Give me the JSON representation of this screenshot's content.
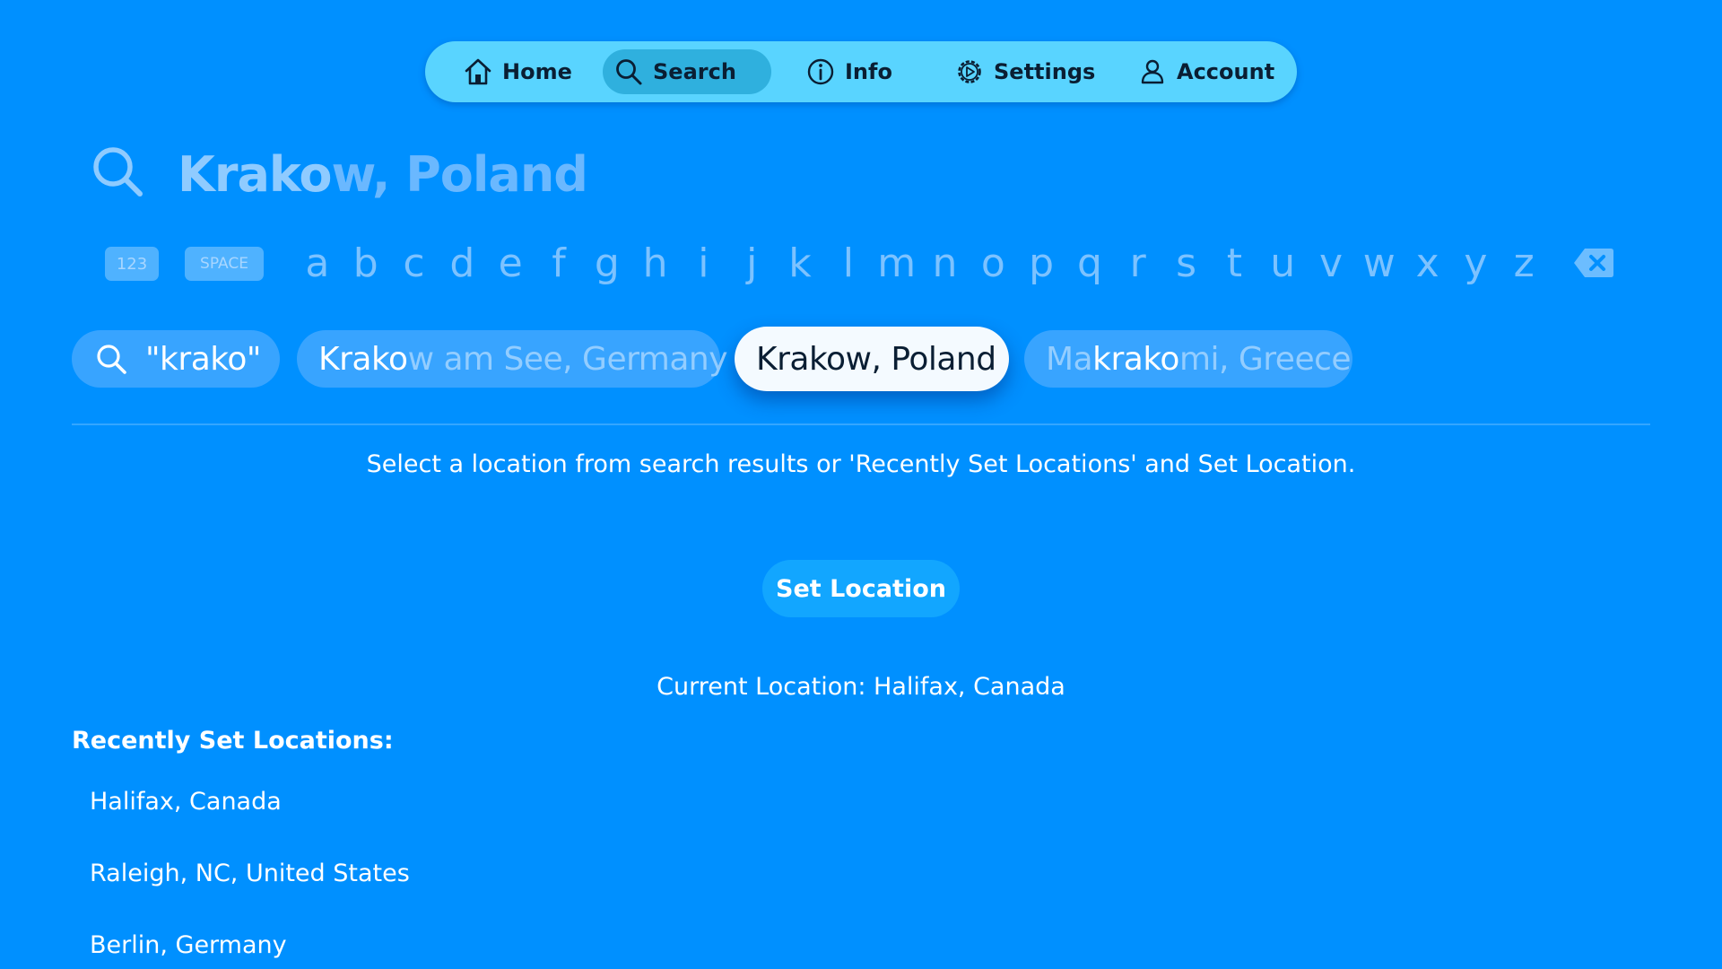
{
  "nav": {
    "items": [
      {
        "label": "Home",
        "icon": "house-icon"
      },
      {
        "label": "Search",
        "icon": "magnifier-icon",
        "active": true
      },
      {
        "label": "Info",
        "icon": "info-icon"
      },
      {
        "label": "Settings",
        "icon": "gear-icon"
      },
      {
        "label": "Account",
        "icon": "person-icon"
      }
    ]
  },
  "search": {
    "typed": "Krako",
    "suggestion_rest": "w, Poland"
  },
  "keyboard": {
    "numbers_key": "123",
    "space_key": "SPACE",
    "letters": [
      "a",
      "b",
      "c",
      "d",
      "e",
      "f",
      "g",
      "h",
      "i",
      "j",
      "k",
      "l",
      "m",
      "n",
      "o",
      "p",
      "q",
      "r",
      "s",
      "t",
      "u",
      "v",
      "w",
      "x",
      "y",
      "z"
    ],
    "backspace_icon": "backspace-icon"
  },
  "results": {
    "query_chip": "\"krako\"",
    "items": [
      {
        "pre": "",
        "match": "Krako",
        "post": "w am See, Germany"
      },
      {
        "label": "Krakow, Poland",
        "selected": true
      },
      {
        "pre": "Ma",
        "match": "krako",
        "post": "mi, Greece"
      }
    ]
  },
  "instruction": "Select a location from search results or 'Recently Set Locations' and Set Location.",
  "set_location_button": "Set Location",
  "current_location": "Current Location: Halifax, Canada",
  "recent": {
    "title": "Recently Set Locations:",
    "items": [
      "Halifax, Canada",
      "Raleigh, NC, United States",
      "Berlin, Germany"
    ]
  },
  "colors": {
    "background": "#0090FF",
    "nav_bar": "#59D4FF",
    "nav_active": "#2FB0DE",
    "chip": "#38A4FF",
    "chip_selected": "#F4FAFF",
    "button": "#12A6FF"
  }
}
